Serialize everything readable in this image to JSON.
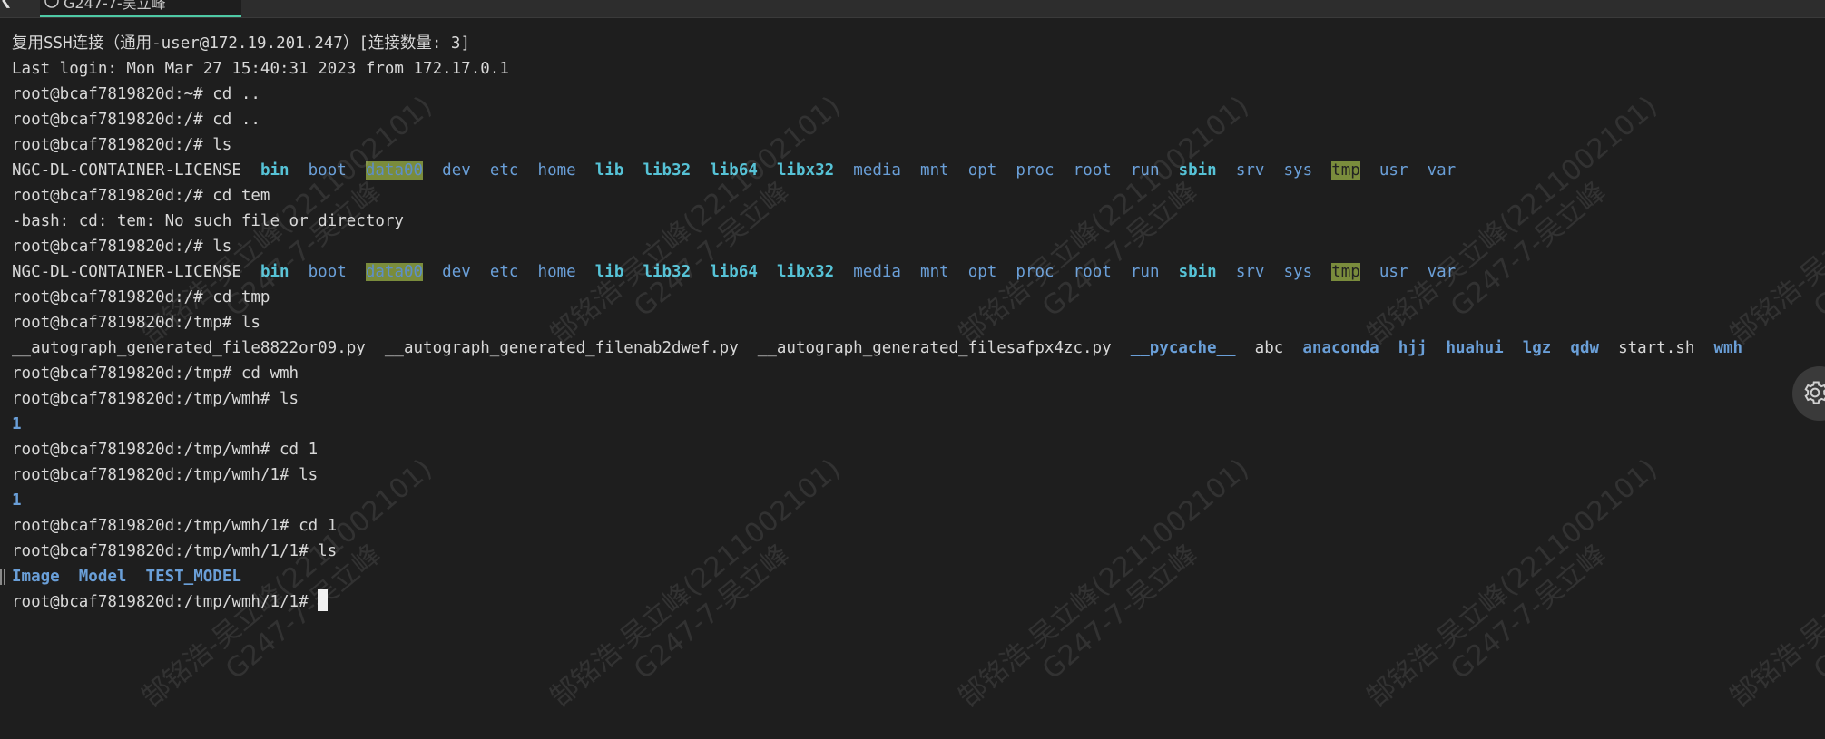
{
  "tab": {
    "label": "G247-7-吴立峰"
  },
  "terminal": {
    "lines": [
      [
        {
          "t": "复用SSH连接（通用-user@172.19.201.247）[连接数量: 3]",
          "c": "plain"
        }
      ],
      [
        {
          "t": "Last login: Mon Mar 27 15:40:31 2023 from 172.17.0.1",
          "c": "plain"
        }
      ],
      [
        {
          "t": "root@bcaf7819820d:~# cd ..",
          "c": "plain"
        }
      ],
      [
        {
          "t": "root@bcaf7819820d:/# cd ..",
          "c": "plain"
        }
      ],
      [
        {
          "t": "root@bcaf7819820d:/# ls",
          "c": "plain"
        }
      ],
      [
        {
          "t": "NGC-DL-CONTAINER-LICENSE  ",
          "c": "plain"
        },
        {
          "t": "bin",
          "c": "link"
        },
        {
          "t": "  ",
          "c": "plain"
        },
        {
          "t": "boot",
          "c": "dir"
        },
        {
          "t": "  ",
          "c": "plain"
        },
        {
          "t": "data00",
          "c": "hl"
        },
        {
          "t": "  ",
          "c": "plain"
        },
        {
          "t": "dev",
          "c": "dir"
        },
        {
          "t": "  ",
          "c": "plain"
        },
        {
          "t": "etc",
          "c": "dir"
        },
        {
          "t": "  ",
          "c": "plain"
        },
        {
          "t": "home",
          "c": "dir"
        },
        {
          "t": "  ",
          "c": "plain"
        },
        {
          "t": "lib",
          "c": "link"
        },
        {
          "t": "  ",
          "c": "plain"
        },
        {
          "t": "lib32",
          "c": "link"
        },
        {
          "t": "  ",
          "c": "plain"
        },
        {
          "t": "lib64",
          "c": "link"
        },
        {
          "t": "  ",
          "c": "plain"
        },
        {
          "t": "libx32",
          "c": "link"
        },
        {
          "t": "  ",
          "c": "plain"
        },
        {
          "t": "media",
          "c": "dir"
        },
        {
          "t": "  ",
          "c": "plain"
        },
        {
          "t": "mnt",
          "c": "dir"
        },
        {
          "t": "  ",
          "c": "plain"
        },
        {
          "t": "opt",
          "c": "dir"
        },
        {
          "t": "  ",
          "c": "plain"
        },
        {
          "t": "proc",
          "c": "dir"
        },
        {
          "t": "  ",
          "c": "plain"
        },
        {
          "t": "root",
          "c": "dir"
        },
        {
          "t": "  ",
          "c": "plain"
        },
        {
          "t": "run",
          "c": "dir"
        },
        {
          "t": "  ",
          "c": "plain"
        },
        {
          "t": "sbin",
          "c": "link"
        },
        {
          "t": "  ",
          "c": "plain"
        },
        {
          "t": "srv",
          "c": "dir"
        },
        {
          "t": "  ",
          "c": "plain"
        },
        {
          "t": "sys",
          "c": "dir"
        },
        {
          "t": "  ",
          "c": "plain"
        },
        {
          "t": "tmp",
          "c": "hl2"
        },
        {
          "t": "  ",
          "c": "plain"
        },
        {
          "t": "usr",
          "c": "dir"
        },
        {
          "t": "  ",
          "c": "plain"
        },
        {
          "t": "var",
          "c": "dir"
        }
      ],
      [
        {
          "t": "root@bcaf7819820d:/# cd tem",
          "c": "plain"
        }
      ],
      [
        {
          "t": "-bash: cd: tem: No such file or directory",
          "c": "plain"
        }
      ],
      [
        {
          "t": "root@bcaf7819820d:/# ls",
          "c": "plain"
        }
      ],
      [
        {
          "t": "NGC-DL-CONTAINER-LICENSE  ",
          "c": "plain"
        },
        {
          "t": "bin",
          "c": "link"
        },
        {
          "t": "  ",
          "c": "plain"
        },
        {
          "t": "boot",
          "c": "dir"
        },
        {
          "t": "  ",
          "c": "plain"
        },
        {
          "t": "data00",
          "c": "hl"
        },
        {
          "t": "  ",
          "c": "plain"
        },
        {
          "t": "dev",
          "c": "dir"
        },
        {
          "t": "  ",
          "c": "plain"
        },
        {
          "t": "etc",
          "c": "dir"
        },
        {
          "t": "  ",
          "c": "plain"
        },
        {
          "t": "home",
          "c": "dir"
        },
        {
          "t": "  ",
          "c": "plain"
        },
        {
          "t": "lib",
          "c": "link"
        },
        {
          "t": "  ",
          "c": "plain"
        },
        {
          "t": "lib32",
          "c": "link"
        },
        {
          "t": "  ",
          "c": "plain"
        },
        {
          "t": "lib64",
          "c": "link"
        },
        {
          "t": "  ",
          "c": "plain"
        },
        {
          "t": "libx32",
          "c": "link"
        },
        {
          "t": "  ",
          "c": "plain"
        },
        {
          "t": "media",
          "c": "dir"
        },
        {
          "t": "  ",
          "c": "plain"
        },
        {
          "t": "mnt",
          "c": "dir"
        },
        {
          "t": "  ",
          "c": "plain"
        },
        {
          "t": "opt",
          "c": "dir"
        },
        {
          "t": "  ",
          "c": "plain"
        },
        {
          "t": "proc",
          "c": "dir"
        },
        {
          "t": "  ",
          "c": "plain"
        },
        {
          "t": "root",
          "c": "dir"
        },
        {
          "t": "  ",
          "c": "plain"
        },
        {
          "t": "run",
          "c": "dir"
        },
        {
          "t": "  ",
          "c": "plain"
        },
        {
          "t": "sbin",
          "c": "link"
        },
        {
          "t": "  ",
          "c": "plain"
        },
        {
          "t": "srv",
          "c": "dir"
        },
        {
          "t": "  ",
          "c": "plain"
        },
        {
          "t": "sys",
          "c": "dir"
        },
        {
          "t": "  ",
          "c": "plain"
        },
        {
          "t": "tmp",
          "c": "hl2"
        },
        {
          "t": "  ",
          "c": "plain"
        },
        {
          "t": "usr",
          "c": "dir"
        },
        {
          "t": "  ",
          "c": "plain"
        },
        {
          "t": "var",
          "c": "dir"
        }
      ],
      [
        {
          "t": "root@bcaf7819820d:/# cd tmp",
          "c": "plain"
        }
      ],
      [
        {
          "t": "root@bcaf7819820d:/tmp# ls",
          "c": "plain"
        }
      ],
      [
        {
          "t": "__autograph_generated_file8822or09.py  __autograph_generated_filenab2dwef.py  __autograph_generated_filesafpx4zc.py  ",
          "c": "plain"
        },
        {
          "t": "__pycache__",
          "c": "dirb"
        },
        {
          "t": "  abc  ",
          "c": "plain"
        },
        {
          "t": "anaconda",
          "c": "dirb"
        },
        {
          "t": "  ",
          "c": "plain"
        },
        {
          "t": "hjj",
          "c": "dirb"
        },
        {
          "t": "  ",
          "c": "plain"
        },
        {
          "t": "huahui",
          "c": "dirb"
        },
        {
          "t": "  ",
          "c": "plain"
        },
        {
          "t": "lgz",
          "c": "dirb"
        },
        {
          "t": "  ",
          "c": "plain"
        },
        {
          "t": "qdw",
          "c": "dirb"
        },
        {
          "t": "  start.sh  ",
          "c": "plain"
        },
        {
          "t": "wmh",
          "c": "dirb"
        }
      ],
      [
        {
          "t": "root@bcaf7819820d:/tmp# cd wmh",
          "c": "plain"
        }
      ],
      [
        {
          "t": "root@bcaf7819820d:/tmp/wmh# ls",
          "c": "plain"
        }
      ],
      [
        {
          "t": "1",
          "c": "dirb"
        }
      ],
      [
        {
          "t": "root@bcaf7819820d:/tmp/wmh# cd 1",
          "c": "plain"
        }
      ],
      [
        {
          "t": "root@bcaf7819820d:/tmp/wmh/1# ls",
          "c": "plain"
        }
      ],
      [
        {
          "t": "1",
          "c": "dirb"
        }
      ],
      [
        {
          "t": "root@bcaf7819820d:/tmp/wmh/1# cd 1",
          "c": "plain"
        }
      ],
      [
        {
          "t": "root@bcaf7819820d:/tmp/wmh/1/1# ls",
          "c": "plain"
        }
      ],
      [
        {
          "t": "Image",
          "c": "dirb"
        },
        {
          "t": "  ",
          "c": "plain"
        },
        {
          "t": "Model",
          "c": "dirb"
        },
        {
          "t": "  ",
          "c": "plain"
        },
        {
          "t": "TEST_MODEL",
          "c": "dirb"
        }
      ],
      [
        {
          "t": "root@bcaf7819820d:/tmp/wmh/1/1# ",
          "c": "plain"
        }
      ]
    ]
  },
  "watermark": {
    "line1": "郜铭浩-吴立峰(2211002101)",
    "line2": "G247-7-吴立峰"
  },
  "icons": {
    "tab": "terminal-icon",
    "settings": "gear-icon"
  },
  "colors": {
    "background": "#1e1e1e",
    "accent": "#4ec9a5",
    "directory": "#6a9fd8",
    "link": "#56c2d6",
    "highlight": "#7a8c3c"
  }
}
